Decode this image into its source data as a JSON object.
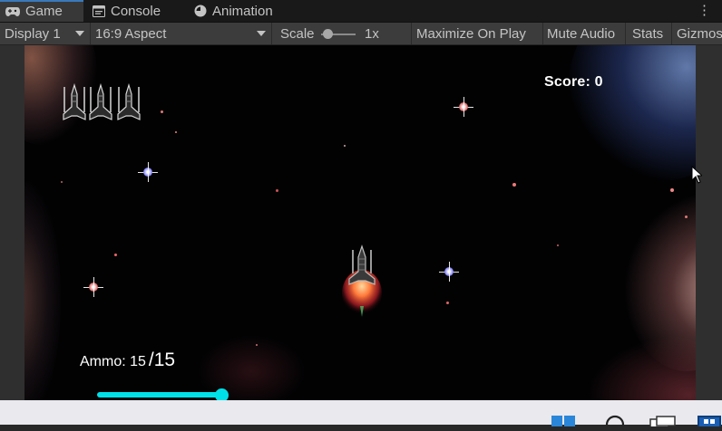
{
  "tabs": [
    {
      "label": "Game",
      "icon": "gamepad-icon",
      "active": true
    },
    {
      "label": "Console",
      "icon": "console-icon",
      "active": false
    },
    {
      "label": "Animation",
      "icon": "animation-clock-icon",
      "active": false
    }
  ],
  "toolbar": {
    "display": "Display 1",
    "aspect": "16:9 Aspect",
    "scale_label": "Scale",
    "scale_value": "1x",
    "maximize_on_play": "Maximize On Play",
    "mute_audio": "Mute Audio",
    "stats": "Stats",
    "gizmos": "Gizmos"
  },
  "game": {
    "score": "Score: 0",
    "ammo_label": "Ammo: 15",
    "ammo_max": "/15",
    "ammo_fill_fraction": 1.0,
    "lives_count": 3,
    "accent_color": "#00e0e8"
  },
  "taskbar": {
    "icons": [
      "windows-start-icon",
      "search-icon",
      "task-view-icon",
      "store-icon"
    ]
  }
}
